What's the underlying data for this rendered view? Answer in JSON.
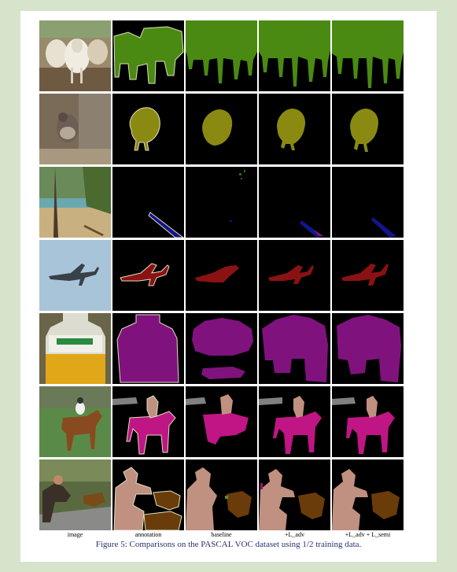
{
  "figure": {
    "column_labels": [
      "image",
      "annotation",
      "baseline",
      "+L_adv",
      "+L_adv + L_semi"
    ],
    "caption": "Figure 5: Comparisons on the PASCAL VOC dataset using 1/2 training data.",
    "rows": [
      "cows",
      "bird",
      "boat",
      "aeroplane",
      "bottle",
      "horse-person",
      "person-dog"
    ]
  },
  "colors": {
    "cow": "#4a8a12",
    "bird": "#8a8a12",
    "boat": "#14148a",
    "aeroplane": "#8a1212",
    "bottle": "#80127e",
    "horse": "#c01584",
    "person": "#c09080",
    "dog": "#6a3c0a",
    "background": "#000000",
    "outline": "#e0e0c0"
  }
}
